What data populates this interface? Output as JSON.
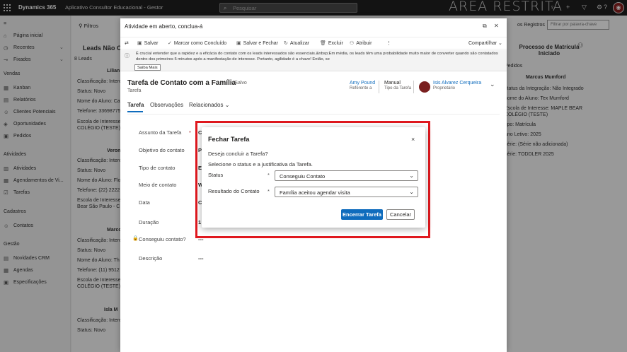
{
  "topbar": {
    "brand": "Dynamics 365",
    "app_name": "Aplicativo Consultor Educacional - Gestor",
    "search_placeholder": "Pesquisar",
    "restricted_label": "ÁREA RESTRITA",
    "icons": [
      "lightbulb-icon",
      "plus-icon",
      "filter-icon",
      "gear-icon",
      "help-icon"
    ]
  },
  "leftnav": {
    "items_top": [
      {
        "icon": "home-icon",
        "label": "Página inicial"
      },
      {
        "icon": "clock-icon",
        "label": "Recentes",
        "chevron": true
      },
      {
        "icon": "pin-icon",
        "label": "Fixados",
        "chevron": true
      }
    ],
    "groups": [
      {
        "title": "Vendas",
        "items": [
          "Kanban",
          "Relatórios",
          "Clientes Potenciais",
          "Oportunidades",
          "Pedidos"
        ]
      },
      {
        "title": "Atividades",
        "items": [
          "Atividades",
          "Agendamentos de Vi...",
          "Tarefas"
        ]
      },
      {
        "title": "Cadastros",
        "items": [
          "Contatos"
        ]
      },
      {
        "title": "Gestão",
        "items": [
          "Novidades CRM",
          "Agendas",
          "Especificações"
        ]
      }
    ]
  },
  "background": {
    "filters_label": "Filtros",
    "leads_header": "Leads Não C",
    "leads_count": "8 Leads",
    "cards": [
      {
        "name": "Lilian",
        "lines": [
          "Classificação: Intere",
          "Status: Novo",
          "Nome do Aluno: Ca",
          "Telefone: 33698775",
          "Escola de Interesse",
          "COLÉGIO (TESTE)"
        ]
      },
      {
        "name": "Veron",
        "lines": [
          "Classificação: Intere",
          "Status: Novo",
          "Nome do Aluno: Flo",
          "Telefone: (22) 2222",
          "Escola de Interesse",
          "Bear São Paulo - C"
        ]
      },
      {
        "name": "Marco",
        "lines": [
          "Classificação: Intere",
          "Status: Novo",
          "Nome do Aluno: Th",
          "Telefone: (11) 9512",
          "Escola de Interesse",
          "COLÉGIO (TESTE)"
        ]
      },
      {
        "name": "Isla M",
        "lines": [
          "Classificação: Intere",
          "Status: Novo"
        ]
      }
    ],
    "right_panel": {
      "registers_btn": "os Registros",
      "filter_placeholder": "Filtrar por palavra-chave",
      "process_title": "Processo de Matrícula Iniciado",
      "tab_pedidos": "Pedidos",
      "person": "Marcus Mumford",
      "lines": [
        "status da Integração: Não Integrado",
        "nome do Aluno: Tex Mumford",
        "Escola de Interesse: MAPLE BEAR",
        "COLÉGIO (TESTE)",
        "tipo: Matrícula",
        "ano Letivo: 2025",
        "série: (Série não adicionada)",
        "série: TODDLER 2025"
      ]
    }
  },
  "panel": {
    "title": "Atividade em aberto, conclua-á",
    "commands": [
      "Salvar",
      "Marcar como Concluído",
      "Salvar e Fechar",
      "Atualizar",
      "Excluir",
      "Atribuir",
      "⋮"
    ],
    "share_label": "Compartilhar",
    "notice_text": "É crucial entender que a rapidez e a eficácia do contato com os leads interessados são essenciais.&nbsp;Em média, os leads têm uma probabilidade muito maior de converter quando são contatados dentro dos primeiros 5 minutos após a manifestação de interesse. Portanto, agilidade é a chave! Então, se",
    "notice_button": "Saiba Mais",
    "record_title": "Tarefa de Contato com a Família",
    "record_saved": "- Salvo",
    "record_entity": "Tarefa",
    "header_fields": [
      {
        "value": "Amy Pound",
        "label": "Referente a"
      },
      {
        "value": "Manual",
        "label": "Tipo da Tarefa"
      },
      {
        "value": "Isis Alvarez Cerqueira",
        "label": "Proprietário"
      }
    ],
    "tabs": [
      "Tarefa",
      "Observações",
      "Relacionados"
    ],
    "fields": [
      {
        "label": "Assunto da Tarefa",
        "required": true,
        "value": "C"
      },
      {
        "label": "Objetivo do contato",
        "required": false,
        "value": "P"
      },
      {
        "label": "Tipo de contato",
        "required": false,
        "value": "E"
      },
      {
        "label": "Meio de contato",
        "required": false,
        "value": "W"
      },
      {
        "label": "Data",
        "required": false,
        "value": "C"
      },
      {
        "label": "Duração",
        "required": false,
        "value": "1"
      },
      {
        "label": "Conseguiu contato?",
        "required": false,
        "value": "---"
      },
      {
        "label": "Descrição",
        "required": false,
        "value": "---"
      }
    ]
  },
  "dialog": {
    "title": "Fechar Tarefa",
    "question": "Deseja concluir a Tarefa?",
    "instruction": "Selecione o status e a justificativa da Tarefa.",
    "status_label": "Status",
    "status_value": "Conseguiu Contato",
    "result_label": "Resultado do Contato",
    "result_value": "Família aceitou agendar visita",
    "required_mark": "*",
    "confirm_label": "Encerrar Tarefa",
    "cancel_label": "Cancelar",
    "close_glyph": "×"
  },
  "colors": {
    "primary": "#0f6cbd",
    "highlight": "#e0181e",
    "topbar": "#1f1f1f"
  }
}
